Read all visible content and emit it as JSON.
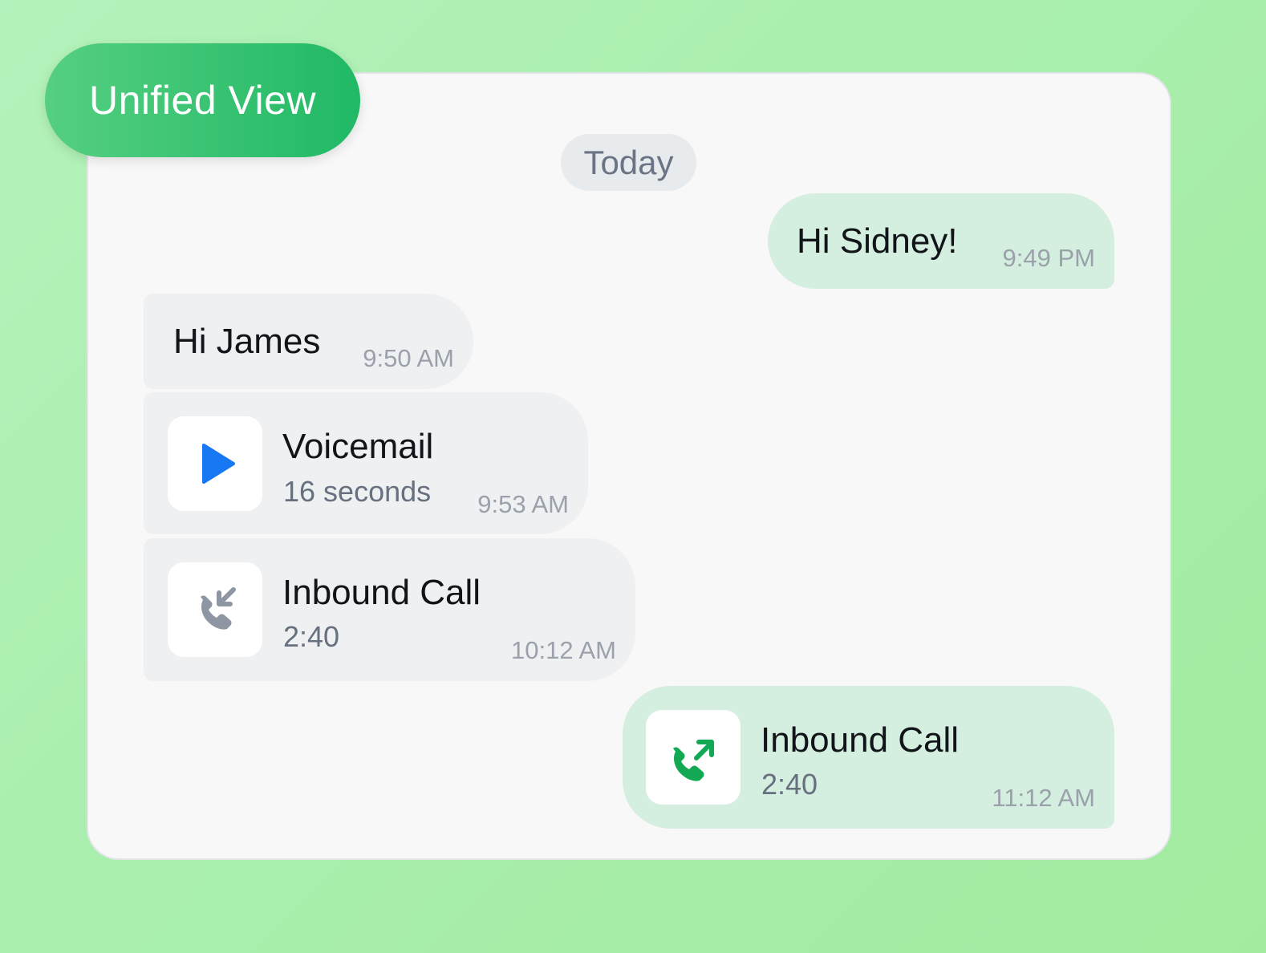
{
  "header": {
    "badge_label": "Unified View"
  },
  "conversation": {
    "date_separator": "Today",
    "messages": [
      {
        "type": "text",
        "direction": "outgoing",
        "text": "Hi Sidney!",
        "time": "9:49 PM"
      },
      {
        "type": "text",
        "direction": "incoming",
        "text": "Hi James",
        "time": "9:50 AM"
      },
      {
        "type": "voicemail",
        "direction": "incoming",
        "title": "Voicemail",
        "subtitle": "16 seconds",
        "time": "9:53 AM",
        "icon": "play-icon"
      },
      {
        "type": "call",
        "direction": "incoming",
        "title": "Inbound Call",
        "subtitle": "2:40",
        "time": "10:12 AM",
        "icon": "incoming-call-icon"
      },
      {
        "type": "call",
        "direction": "outgoing",
        "title": "Inbound Call",
        "subtitle": "2:40",
        "time": "11:12 AM",
        "icon": "outgoing-call-icon"
      }
    ]
  },
  "colors": {
    "badge_green": "#20b965",
    "play_blue": "#1877f2",
    "call_gray": "#8e96a3",
    "call_green": "#12a854",
    "outgoing_bubble": "#d4eedf",
    "incoming_bubble": "#eff0f2"
  }
}
